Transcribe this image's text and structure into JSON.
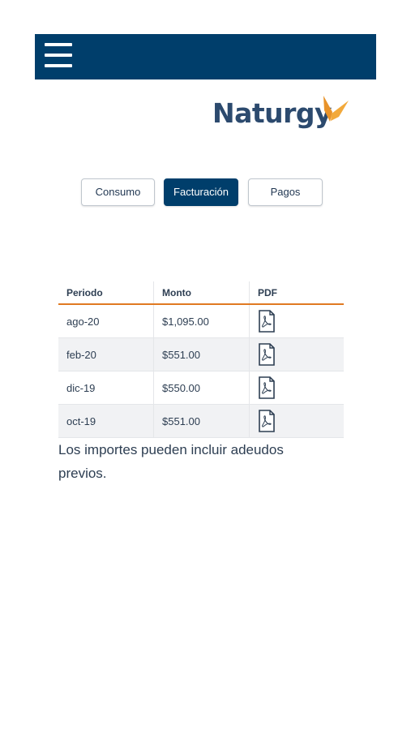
{
  "header": {
    "menu_icon": "hamburger-menu-icon"
  },
  "logo": {
    "text": "Naturgy",
    "brand_color": "#2c4a6e",
    "accent_color": "#e8932a"
  },
  "tabs": [
    {
      "label": "Consumo",
      "active": false
    },
    {
      "label": "Facturación",
      "active": true
    },
    {
      "label": "Pagos",
      "active": false
    }
  ],
  "table": {
    "headers": [
      "Periodo",
      "Monto",
      "PDF"
    ],
    "rows": [
      {
        "periodo": "ago-20",
        "monto": "$1,095.00",
        "pdf_icon": "pdf-icon"
      },
      {
        "periodo": "feb-20",
        "monto": "$551.00",
        "pdf_icon": "pdf-icon"
      },
      {
        "periodo": "dic-19",
        "monto": "$550.00",
        "pdf_icon": "pdf-icon"
      },
      {
        "periodo": "oct-19",
        "monto": "$551.00",
        "pdf_icon": "pdf-icon"
      }
    ]
  },
  "note": "Los importes pueden incluir adeudos previos.",
  "colors": {
    "primary": "#003e6b",
    "accent_line": "#e07a22",
    "row_alt": "#f1f2f4"
  }
}
